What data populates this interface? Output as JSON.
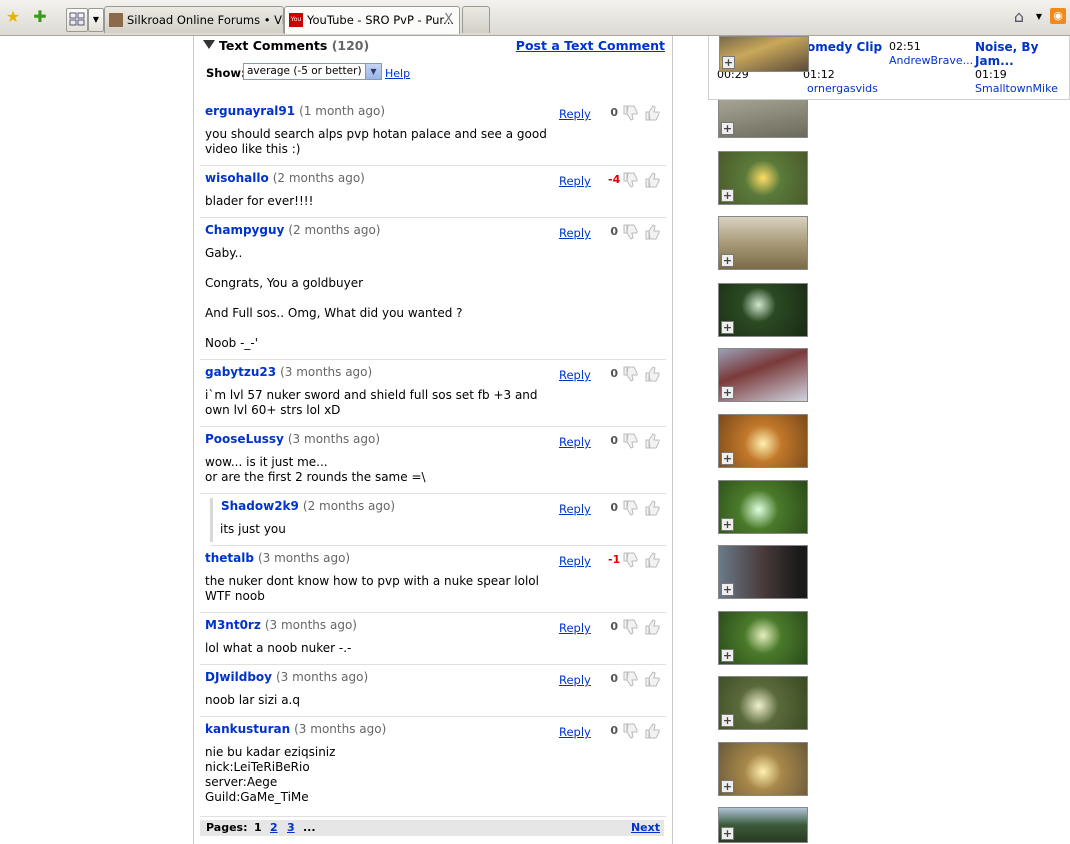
{
  "browser": {
    "tabs": [
      {
        "label": "Silkroad Online Forums • Vie..."
      },
      {
        "label": "YouTube - SRO PvP - Pur...",
        "close": "X"
      }
    ]
  },
  "comments_section": {
    "title": "Text Comments",
    "count": "(120)",
    "post_link": "Post a Text Comment",
    "show_label": "Show:",
    "filter_value": "average (-5 or better)",
    "help_label": "Help",
    "reply_label": "Reply",
    "comments": [
      {
        "author": "ergunayral91",
        "age": "(1 month ago)",
        "score": "0",
        "body": "you should search alps pvp hotan palace and see a good video like this :)"
      },
      {
        "author": "wisohallo",
        "age": "(2 months ago)",
        "score": "-4",
        "body": "blader for ever!!!!"
      },
      {
        "author": "Champyguy",
        "age": "(2 months ago)",
        "score": "0",
        "body": "Gaby..\n\nCongrats, You a goldbuyer\n\nAnd Full sos.. Omg, What did you wanted ?\n\nNoob -_-'"
      },
      {
        "author": "gabytzu23",
        "age": "(3 months ago)",
        "score": "0",
        "body": "i`m lvl 57 nuker sword and shield full sos set fb +3 and own lvl 60+ strs lol xD"
      },
      {
        "author": "PooseLussy",
        "age": "(3 months ago)",
        "score": "0",
        "body": "wow... is it just me...\nor are the first 2 rounds the same =\\"
      },
      {
        "author": "Shadow2k9",
        "age": "(2 months ago)",
        "score": "0",
        "body": "its just you"
      },
      {
        "author": "thetalb",
        "age": "(3 months ago)",
        "score": "-1",
        "body": "the nuker dont know how to pvp with a nuke spear lolol WTF noob"
      },
      {
        "author": "M3nt0rz",
        "age": "(3 months ago)",
        "score": "0",
        "body": "lol what a noob nuker -.-"
      },
      {
        "author": "DJwildboy",
        "age": "(3 months ago)",
        "score": "0",
        "body": "noob lar sizi a.q"
      },
      {
        "author": "kankusturan",
        "age": "(3 months ago)",
        "score": "0",
        "body": "nie bu kadar eziqsiniz\nnick:LeiTeRiBeRio\nserver:Aege\nGuild:GaMe_TiMe"
      }
    ],
    "pager": {
      "label": "Pages:",
      "current": "1",
      "pages": [
        "2",
        "3"
      ],
      "ellipsis": "...",
      "next": "Next"
    }
  },
  "related_popup": {
    "items": [
      {
        "title": "omedy Clip",
        "time": "02:51",
        "user": "AndrewBrave..."
      },
      {
        "title": "Noise, By Jam...",
        "time": "01:19",
        "user": "SmalltownMike"
      }
    ],
    "row2_time_left": "00:29",
    "row2_time": "01:12",
    "row2_user": "ornergasvids"
  },
  "colors": {
    "link": "#0033cc",
    "negative": "#dd0000"
  }
}
